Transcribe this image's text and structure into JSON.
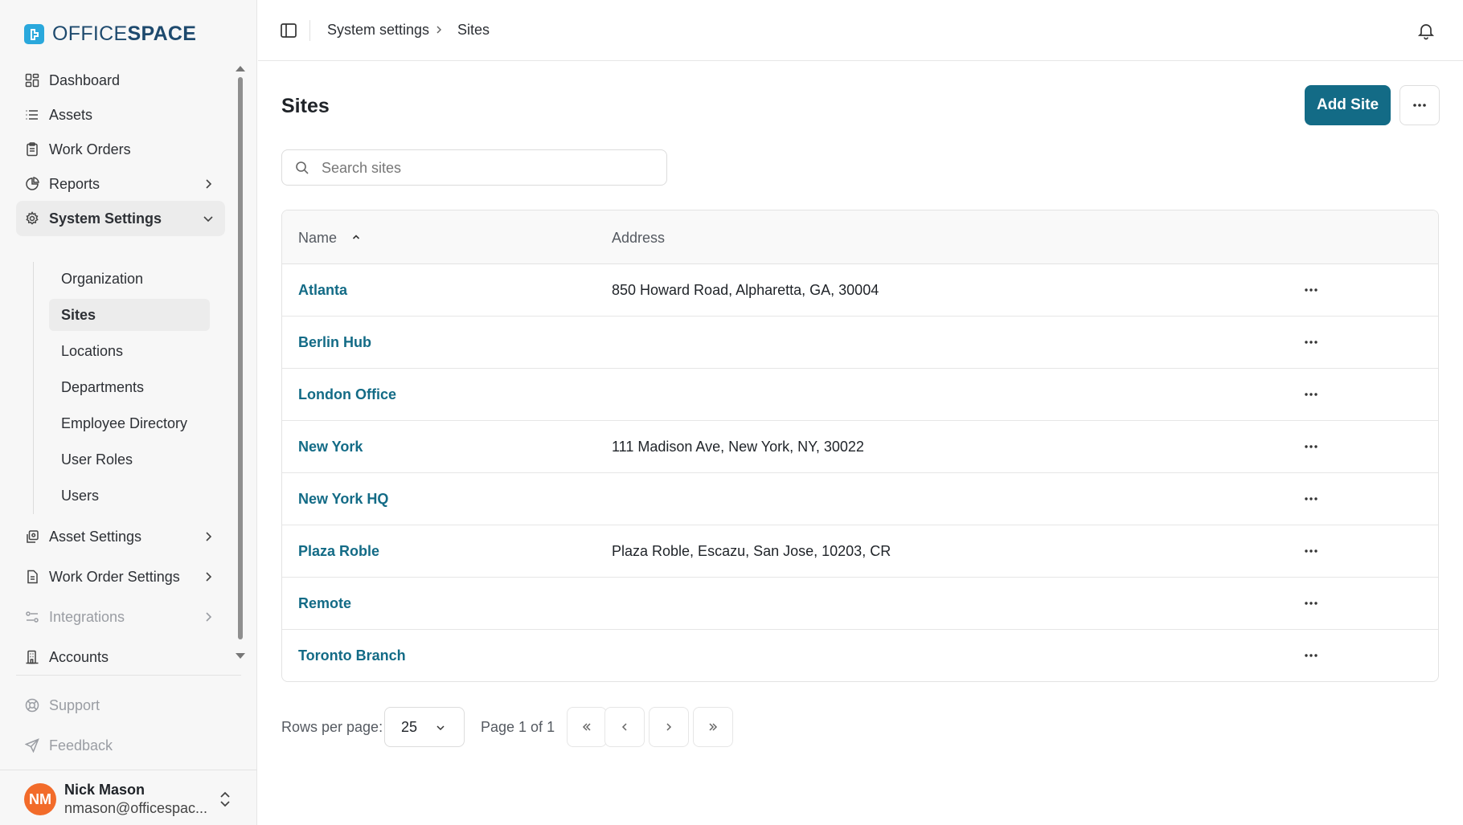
{
  "brand": {
    "logo_light": "OFFICE",
    "logo_bold": "SPACE",
    "accent": "#136b86",
    "logo_color": "#2aa8dc"
  },
  "sidebar": {
    "items": [
      {
        "label": "Dashboard",
        "icon": "dashboard-icon"
      },
      {
        "label": "Assets",
        "icon": "list-icon"
      },
      {
        "label": "Work Orders",
        "icon": "clipboard-icon"
      },
      {
        "label": "Reports",
        "icon": "pie-chart-icon"
      },
      {
        "label": "System Settings",
        "icon": "gear-icon",
        "expanded": true
      },
      {
        "label": "Asset Settings",
        "icon": "asset-settings-icon"
      },
      {
        "label": "Work Order Settings",
        "icon": "document-icon"
      },
      {
        "label": "Integrations",
        "icon": "integrations-icon"
      },
      {
        "label": "Accounts",
        "icon": "building-icon"
      }
    ],
    "sub_items": [
      {
        "label": "Organization"
      },
      {
        "label": "Sites",
        "active": true
      },
      {
        "label": "Locations"
      },
      {
        "label": "Departments"
      },
      {
        "label": "Employee Directory"
      },
      {
        "label": "User Roles"
      },
      {
        "label": "Users"
      }
    ],
    "footer": [
      {
        "label": "Support",
        "icon": "support-icon"
      },
      {
        "label": "Feedback",
        "icon": "send-icon"
      }
    ],
    "user": {
      "initials": "NM",
      "name": "Nick Mason",
      "email": "nmason@officespac...",
      "avatar_color": "#f26b2a"
    }
  },
  "topbar": {
    "breadcrumb": [
      "System settings",
      "Sites"
    ]
  },
  "main": {
    "title": "Sites",
    "add_button": "Add Site",
    "search": {
      "placeholder": "Search sites",
      "value": ""
    },
    "table": {
      "columns": [
        "Name",
        "Address"
      ],
      "sort": {
        "column": "Name",
        "direction": "ascending"
      },
      "rows": [
        {
          "name": "Atlanta",
          "address": "850 Howard Road, Alpharetta, GA, 30004"
        },
        {
          "name": "Berlin Hub",
          "address": ""
        },
        {
          "name": "London Office",
          "address": ""
        },
        {
          "name": "New York",
          "address": "111 Madison Ave, New York, NY, 30022"
        },
        {
          "name": "New York HQ",
          "address": ""
        },
        {
          "name": "Plaza Roble",
          "address": "Plaza Roble, Escazu, San Jose, 10203, CR"
        },
        {
          "name": "Remote",
          "address": ""
        },
        {
          "name": "Toronto Branch",
          "address": ""
        }
      ]
    },
    "pagination": {
      "rows_per_page_label": "Rows per page:",
      "rows_per_page": "25",
      "page_info": "Page 1 of 1"
    }
  }
}
